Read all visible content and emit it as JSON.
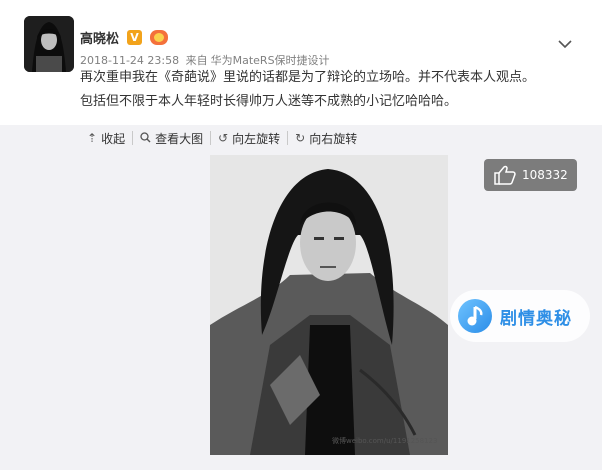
{
  "post": {
    "user_name": "高晓松",
    "verified_label": "V",
    "meta": {
      "timestamp": "2018-11-24 23:58",
      "from_label": "来自",
      "device": "华为MateRS保时捷设计"
    },
    "text_lines": [
      "再次重申我在《奇葩说》里说的话都是为了辩论的立场哈。并不代表本人观点。",
      "包括但不限于本人年轻时长得帅万人迷等不成熟的小记忆哈哈哈。"
    ]
  },
  "media_toolbar": {
    "collapse_label": "收起",
    "view_large_label": "查看大图",
    "rotate_left_label": "向左旋转",
    "rotate_right_label": "向右旋转"
  },
  "like": {
    "count": "108332"
  },
  "watermark_text": "微博weibo.com/u/1191258123",
  "brand": {
    "name": "剧情奥秘"
  },
  "colors": {
    "media_bg": "#f2f2f5",
    "like_bg": "#7c7c7c",
    "brand_blue": "#2f8fe6",
    "verified_orange": "#f2a31b"
  },
  "icons": [
    "chevron-down-icon",
    "collapse-icon",
    "search-icon",
    "rotate-left-icon",
    "rotate-right-icon",
    "thumbs-up-icon",
    "brand-logo-icon"
  ]
}
